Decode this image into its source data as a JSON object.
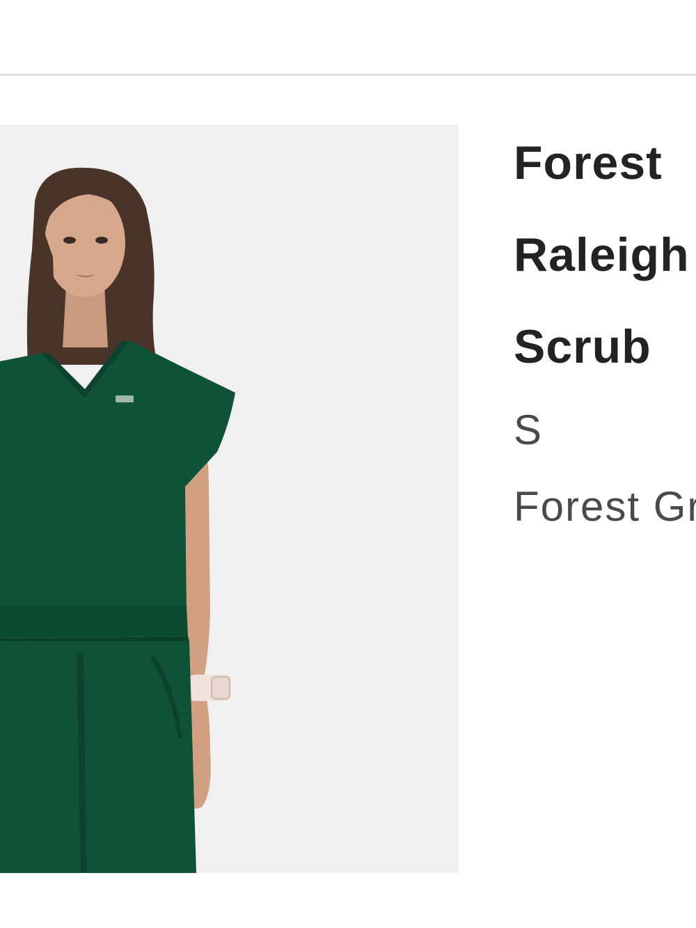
{
  "product": {
    "image_alt": "Woman wearing forest green scrub top and pants",
    "name_lines": [
      "Forest",
      "Raleigh",
      "Scrub"
    ],
    "size": "S",
    "color": "Forest Green"
  },
  "colors": {
    "scrub": "#0f5238",
    "background": "#f0f0f0",
    "title_text": "#232323",
    "variant_text": "#4a4a4a",
    "divider": "#dcdcdc"
  }
}
